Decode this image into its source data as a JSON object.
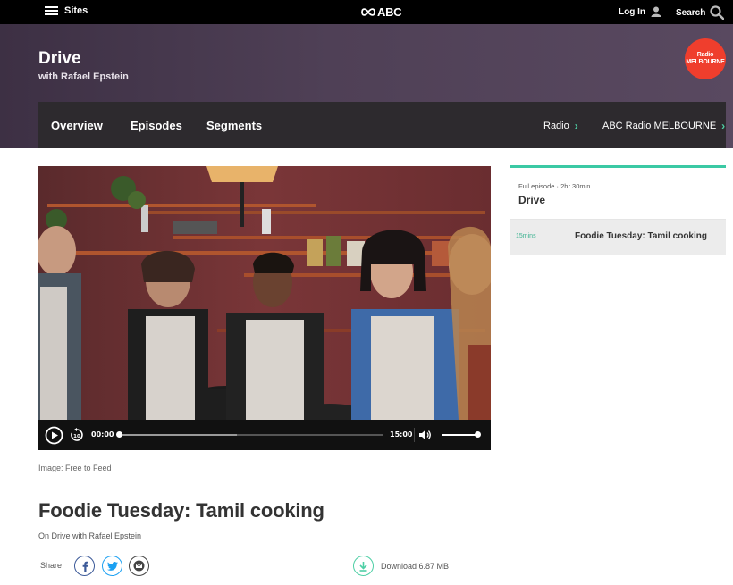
{
  "topbar": {
    "sites_label": "Sites",
    "logo_text": "ABC",
    "login_label": "Log In",
    "search_label": "Search"
  },
  "program": {
    "title": "Drive",
    "host": "with Rafael Epstein",
    "station_logo_line1": "Radio",
    "station_logo_line2": "MELBOURNE"
  },
  "nav": {
    "tabs": [
      {
        "label": "Overview"
      },
      {
        "label": "Episodes"
      },
      {
        "label": "Segments"
      }
    ],
    "crumbs": [
      {
        "label": "Radio"
      },
      {
        "label": "ABC Radio MELBOURNE"
      }
    ]
  },
  "player": {
    "current_time": "00:00",
    "duration": "15:00",
    "progress": 0,
    "buffered": 0.45,
    "volume": 0.9
  },
  "image_caption": "Image: Free to Feed",
  "segment": {
    "title": "Foodie Tuesday: Tamil cooking",
    "subtitle": "On Drive with Rafael Epstein",
    "share_label": "Share",
    "download_label": "Download 6.87 MB"
  },
  "sidebar": {
    "episode_meta": "Full episode · 2hr 30min",
    "episode_title": "Drive",
    "segments": [
      {
        "duration": "15mins",
        "title": "Foodie Tuesday: Tamil cooking"
      }
    ]
  },
  "colors": {
    "accent": "#3bc9a4",
    "station": "#ef3e2d",
    "header": "#4f4056",
    "nav": "#2d2a2e",
    "facebook": "#3b5998",
    "twitter": "#1da1f2"
  }
}
